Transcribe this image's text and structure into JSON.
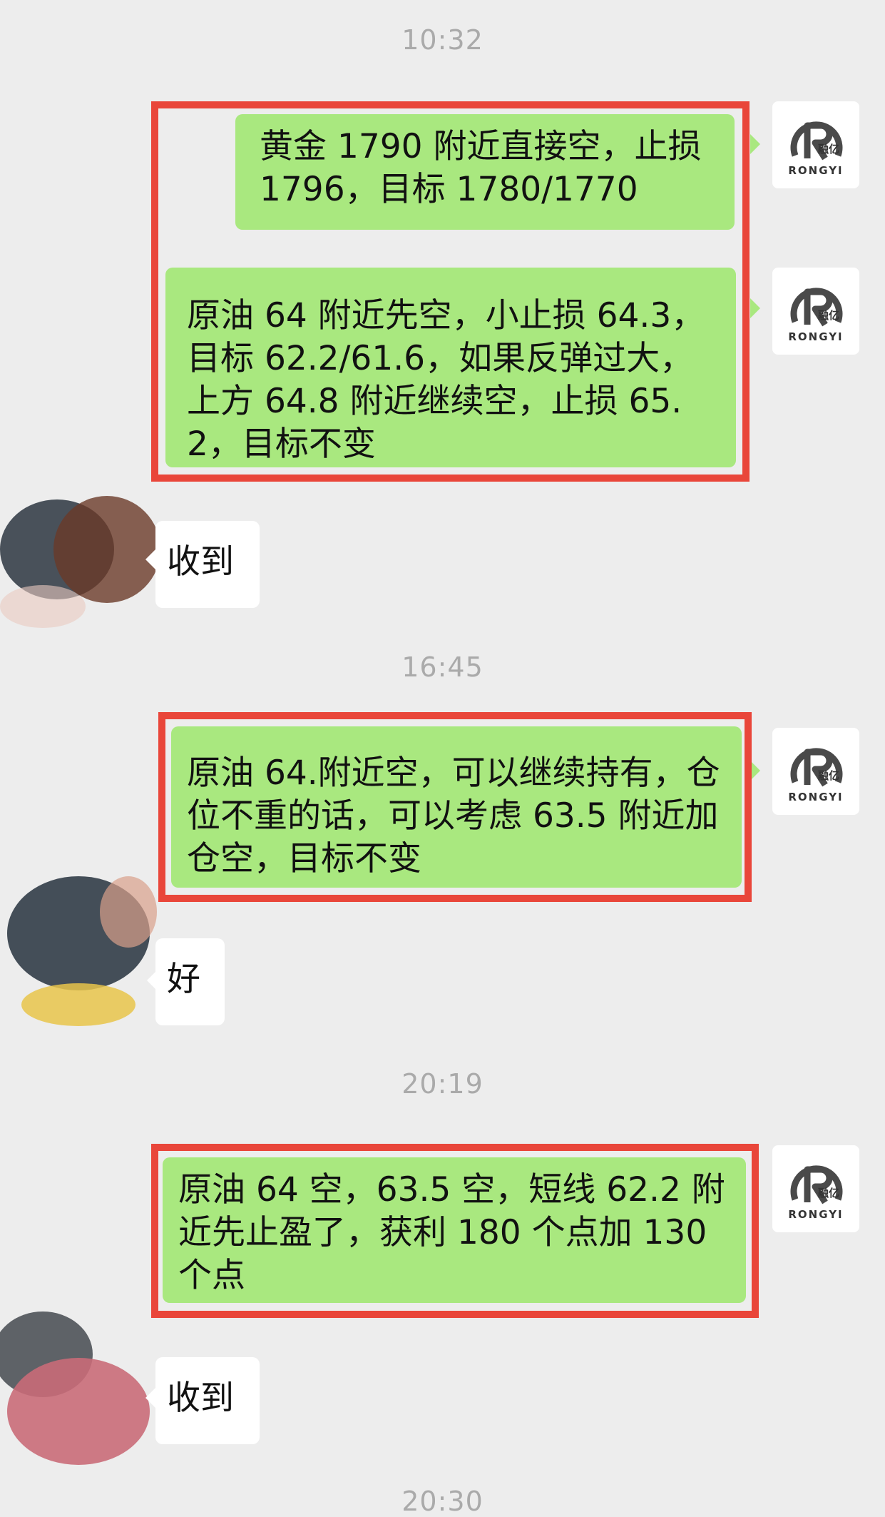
{
  "colors": {
    "background": "#ededed",
    "sent_bubble": "#a9e87f",
    "received_bubble": "#ffffff",
    "highlight_frame": "#e9463a",
    "timestamp": "#aaaaaa"
  },
  "chat": {
    "timestamps": [
      "10:32",
      "16:45",
      "20:19",
      "20:30"
    ],
    "messages": [
      {
        "direction": "sent",
        "text": "黄金 1790 附近直接空，止损 1796，目标 1780/1770"
      },
      {
        "direction": "sent",
        "text": "原油 64 附近先空，小止损 64.3，目标 62.2/61.6，如果反弹过大，上方 64.8 附近继续空，止损 65.2，目标不变"
      },
      {
        "direction": "received",
        "text": "收到"
      },
      {
        "direction": "sent",
        "text": "原油 64.附近空，可以继续持有，仓位不重的话，可以考虑 63.5 附近加仓空，目标不变"
      },
      {
        "direction": "received",
        "text": "好"
      },
      {
        "direction": "sent",
        "text": "原油 64 空，63.5 空，短线 62.2 附近先止盈了，获利 180 个点加 130 个点"
      },
      {
        "direction": "received",
        "text": "收到"
      }
    ],
    "sender_avatar": {
      "brand": "RONGYI",
      "brand_cn": "融亿",
      "icon": "rongyi-logo-icon"
    },
    "receiver_avatar": {
      "icon": "blurred-avatar-icon"
    }
  }
}
